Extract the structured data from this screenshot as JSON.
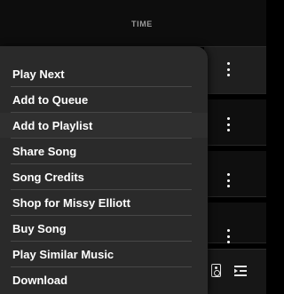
{
  "table": {
    "time_header": "TIME"
  },
  "context_menu": {
    "items": [
      {
        "label": "Play Next"
      },
      {
        "label": "Add to Queue"
      },
      {
        "label": "Add to Playlist"
      },
      {
        "label": "Share Song"
      },
      {
        "label": "Song Credits"
      },
      {
        "label": "Shop for Missy Elliott"
      },
      {
        "label": "Buy Song"
      },
      {
        "label": "Play Similar Music"
      },
      {
        "label": "Download"
      }
    ]
  },
  "icons": {
    "row_more": "more-vertical-icon",
    "speaker": "speaker-icon",
    "queue": "queue-list-icon"
  },
  "colors": {
    "background": "#000000",
    "menu_background": "#2a2a2a",
    "menu_text": "#ffffff",
    "divider": "#474747",
    "header_text": "#9a9a9a"
  }
}
